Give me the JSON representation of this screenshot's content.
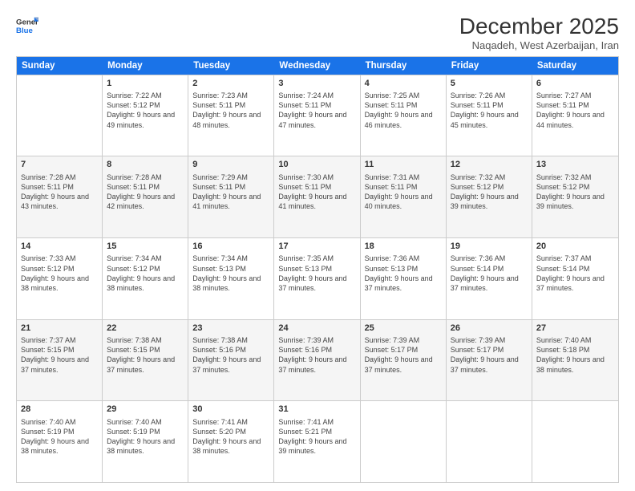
{
  "logo": {
    "line1": "General",
    "line2": "Blue"
  },
  "title": "December 2025",
  "location": "Naqadeh, West Azerbaijan, Iran",
  "header_days": [
    "Sunday",
    "Monday",
    "Tuesday",
    "Wednesday",
    "Thursday",
    "Friday",
    "Saturday"
  ],
  "weeks": [
    [
      {
        "day": "",
        "sunrise": "",
        "sunset": "",
        "daylight": ""
      },
      {
        "day": "1",
        "sunrise": "Sunrise: 7:22 AM",
        "sunset": "Sunset: 5:12 PM",
        "daylight": "Daylight: 9 hours and 49 minutes."
      },
      {
        "day": "2",
        "sunrise": "Sunrise: 7:23 AM",
        "sunset": "Sunset: 5:11 PM",
        "daylight": "Daylight: 9 hours and 48 minutes."
      },
      {
        "day": "3",
        "sunrise": "Sunrise: 7:24 AM",
        "sunset": "Sunset: 5:11 PM",
        "daylight": "Daylight: 9 hours and 47 minutes."
      },
      {
        "day": "4",
        "sunrise": "Sunrise: 7:25 AM",
        "sunset": "Sunset: 5:11 PM",
        "daylight": "Daylight: 9 hours and 46 minutes."
      },
      {
        "day": "5",
        "sunrise": "Sunrise: 7:26 AM",
        "sunset": "Sunset: 5:11 PM",
        "daylight": "Daylight: 9 hours and 45 minutes."
      },
      {
        "day": "6",
        "sunrise": "Sunrise: 7:27 AM",
        "sunset": "Sunset: 5:11 PM",
        "daylight": "Daylight: 9 hours and 44 minutes."
      }
    ],
    [
      {
        "day": "7",
        "sunrise": "Sunrise: 7:28 AM",
        "sunset": "Sunset: 5:11 PM",
        "daylight": "Daylight: 9 hours and 43 minutes."
      },
      {
        "day": "8",
        "sunrise": "Sunrise: 7:28 AM",
        "sunset": "Sunset: 5:11 PM",
        "daylight": "Daylight: 9 hours and 42 minutes."
      },
      {
        "day": "9",
        "sunrise": "Sunrise: 7:29 AM",
        "sunset": "Sunset: 5:11 PM",
        "daylight": "Daylight: 9 hours and 41 minutes."
      },
      {
        "day": "10",
        "sunrise": "Sunrise: 7:30 AM",
        "sunset": "Sunset: 5:11 PM",
        "daylight": "Daylight: 9 hours and 41 minutes."
      },
      {
        "day": "11",
        "sunrise": "Sunrise: 7:31 AM",
        "sunset": "Sunset: 5:11 PM",
        "daylight": "Daylight: 9 hours and 40 minutes."
      },
      {
        "day": "12",
        "sunrise": "Sunrise: 7:32 AM",
        "sunset": "Sunset: 5:12 PM",
        "daylight": "Daylight: 9 hours and 39 minutes."
      },
      {
        "day": "13",
        "sunrise": "Sunrise: 7:32 AM",
        "sunset": "Sunset: 5:12 PM",
        "daylight": "Daylight: 9 hours and 39 minutes."
      }
    ],
    [
      {
        "day": "14",
        "sunrise": "Sunrise: 7:33 AM",
        "sunset": "Sunset: 5:12 PM",
        "daylight": "Daylight: 9 hours and 38 minutes."
      },
      {
        "day": "15",
        "sunrise": "Sunrise: 7:34 AM",
        "sunset": "Sunset: 5:12 PM",
        "daylight": "Daylight: 9 hours and 38 minutes."
      },
      {
        "day": "16",
        "sunrise": "Sunrise: 7:34 AM",
        "sunset": "Sunset: 5:13 PM",
        "daylight": "Daylight: 9 hours and 38 minutes."
      },
      {
        "day": "17",
        "sunrise": "Sunrise: 7:35 AM",
        "sunset": "Sunset: 5:13 PM",
        "daylight": "Daylight: 9 hours and 37 minutes."
      },
      {
        "day": "18",
        "sunrise": "Sunrise: 7:36 AM",
        "sunset": "Sunset: 5:13 PM",
        "daylight": "Daylight: 9 hours and 37 minutes."
      },
      {
        "day": "19",
        "sunrise": "Sunrise: 7:36 AM",
        "sunset": "Sunset: 5:14 PM",
        "daylight": "Daylight: 9 hours and 37 minutes."
      },
      {
        "day": "20",
        "sunrise": "Sunrise: 7:37 AM",
        "sunset": "Sunset: 5:14 PM",
        "daylight": "Daylight: 9 hours and 37 minutes."
      }
    ],
    [
      {
        "day": "21",
        "sunrise": "Sunrise: 7:37 AM",
        "sunset": "Sunset: 5:15 PM",
        "daylight": "Daylight: 9 hours and 37 minutes."
      },
      {
        "day": "22",
        "sunrise": "Sunrise: 7:38 AM",
        "sunset": "Sunset: 5:15 PM",
        "daylight": "Daylight: 9 hours and 37 minutes."
      },
      {
        "day": "23",
        "sunrise": "Sunrise: 7:38 AM",
        "sunset": "Sunset: 5:16 PM",
        "daylight": "Daylight: 9 hours and 37 minutes."
      },
      {
        "day": "24",
        "sunrise": "Sunrise: 7:39 AM",
        "sunset": "Sunset: 5:16 PM",
        "daylight": "Daylight: 9 hours and 37 minutes."
      },
      {
        "day": "25",
        "sunrise": "Sunrise: 7:39 AM",
        "sunset": "Sunset: 5:17 PM",
        "daylight": "Daylight: 9 hours and 37 minutes."
      },
      {
        "day": "26",
        "sunrise": "Sunrise: 7:39 AM",
        "sunset": "Sunset: 5:17 PM",
        "daylight": "Daylight: 9 hours and 37 minutes."
      },
      {
        "day": "27",
        "sunrise": "Sunrise: 7:40 AM",
        "sunset": "Sunset: 5:18 PM",
        "daylight": "Daylight: 9 hours and 38 minutes."
      }
    ],
    [
      {
        "day": "28",
        "sunrise": "Sunrise: 7:40 AM",
        "sunset": "Sunset: 5:19 PM",
        "daylight": "Daylight: 9 hours and 38 minutes."
      },
      {
        "day": "29",
        "sunrise": "Sunrise: 7:40 AM",
        "sunset": "Sunset: 5:19 PM",
        "daylight": "Daylight: 9 hours and 38 minutes."
      },
      {
        "day": "30",
        "sunrise": "Sunrise: 7:41 AM",
        "sunset": "Sunset: 5:20 PM",
        "daylight": "Daylight: 9 hours and 38 minutes."
      },
      {
        "day": "31",
        "sunrise": "Sunrise: 7:41 AM",
        "sunset": "Sunset: 5:21 PM",
        "daylight": "Daylight: 9 hours and 39 minutes."
      },
      {
        "day": "",
        "sunrise": "",
        "sunset": "",
        "daylight": ""
      },
      {
        "day": "",
        "sunrise": "",
        "sunset": "",
        "daylight": ""
      },
      {
        "day": "",
        "sunrise": "",
        "sunset": "",
        "daylight": ""
      }
    ]
  ]
}
